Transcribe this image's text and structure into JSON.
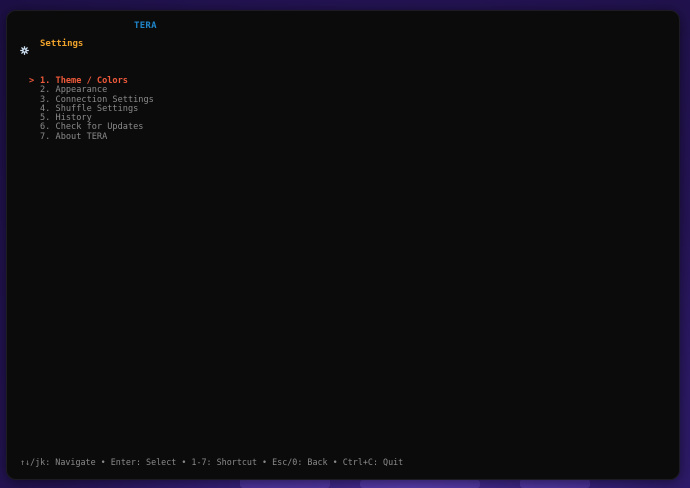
{
  "app": {
    "title": "TERA"
  },
  "header": {
    "icon": "gear-icon",
    "label": "Settings",
    "label_color": "#f0a32a"
  },
  "menu": {
    "cursor_symbol": ">",
    "selected_index": 0,
    "selected_color": "#ef5a3a",
    "items": [
      {
        "label": "1. Theme / Colors"
      },
      {
        "label": "2. Appearance"
      },
      {
        "label": "3. Connection Settings"
      },
      {
        "label": "4. Shuffle Settings"
      },
      {
        "label": "5. History"
      },
      {
        "label": "6. Check for Updates"
      },
      {
        "label": "7. About TERA"
      }
    ]
  },
  "footer": {
    "help_text": "↑↓/jk: Navigate • Enter: Select • 1-7: Shortcut • Esc/0: Back • Ctrl+C: Quit"
  },
  "colors": {
    "title": "#1f86c9",
    "text_muted": "#8a8a8a",
    "window_bg": "#0b0b0c"
  }
}
